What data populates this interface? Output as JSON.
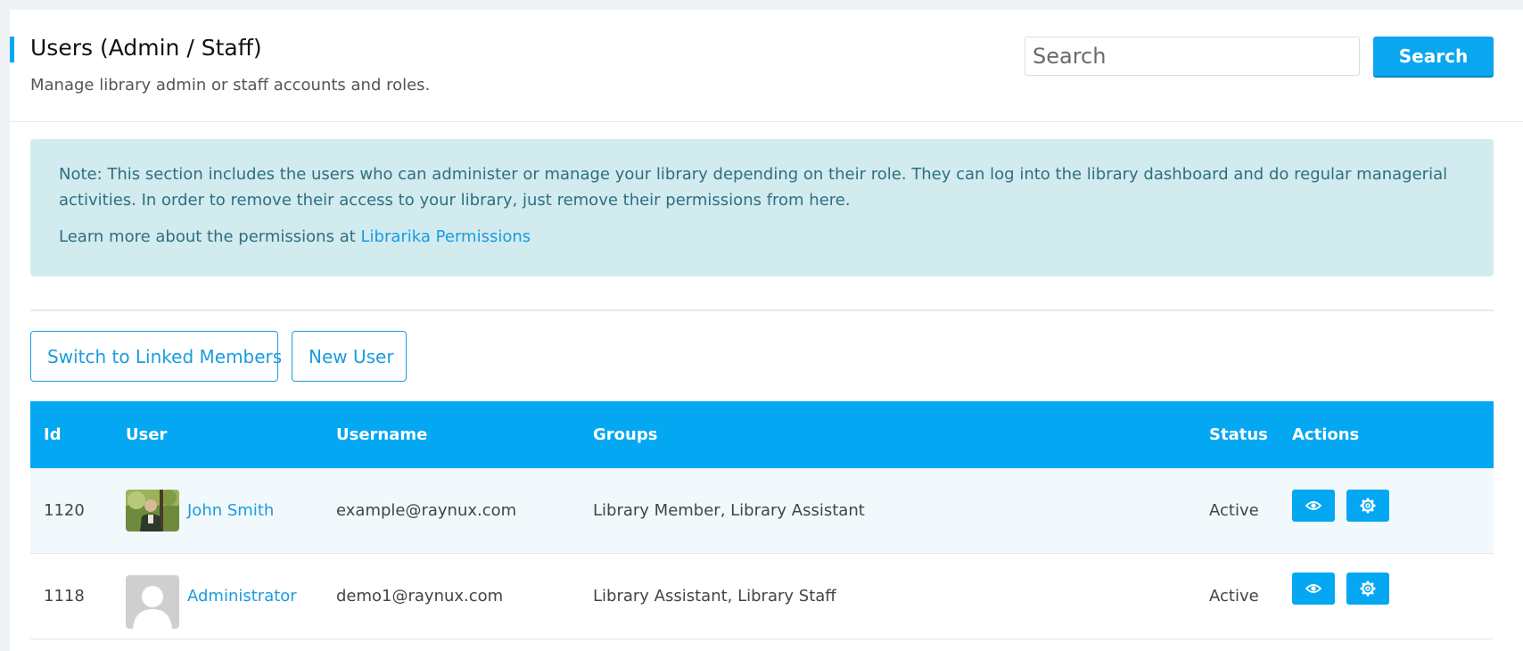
{
  "header": {
    "title": "Users (Admin / Staff)",
    "subtitle": "Manage library admin or staff accounts and roles.",
    "search_placeholder": "Search",
    "search_button": "Search"
  },
  "alert": {
    "note": "Note: This section includes the users who can administer or manage your library depending on their role. They can log into the library dashboard and do regular managerial activities. In order to remove their access to your library, just remove their permissions from here.",
    "learn_more_prefix": "Learn more about the permissions at ",
    "learn_more_link": "Librarika Permissions"
  },
  "actions": {
    "switch_button": "Switch to Linked Members",
    "new_user_button": "New User"
  },
  "table": {
    "columns": [
      "Id",
      "User",
      "Username",
      "Groups",
      "Status",
      "Actions"
    ],
    "rows": [
      {
        "id": "1120",
        "user": "John Smith",
        "avatar": "photo",
        "username": "example@raynux.com",
        "groups": "Library Member, Library Assistant",
        "status": "Active"
      },
      {
        "id": "1118",
        "user": "Administrator",
        "avatar": "placeholder",
        "username": "demo1@raynux.com",
        "groups": "Library Assistant, Library Staff",
        "status": "Active"
      }
    ]
  },
  "icons": {
    "view": "eye-icon",
    "settings": "gear-icon"
  },
  "colors": {
    "accent": "#04a7f2",
    "link": "#1a9be0",
    "alert_bg": "#d1ebef"
  }
}
